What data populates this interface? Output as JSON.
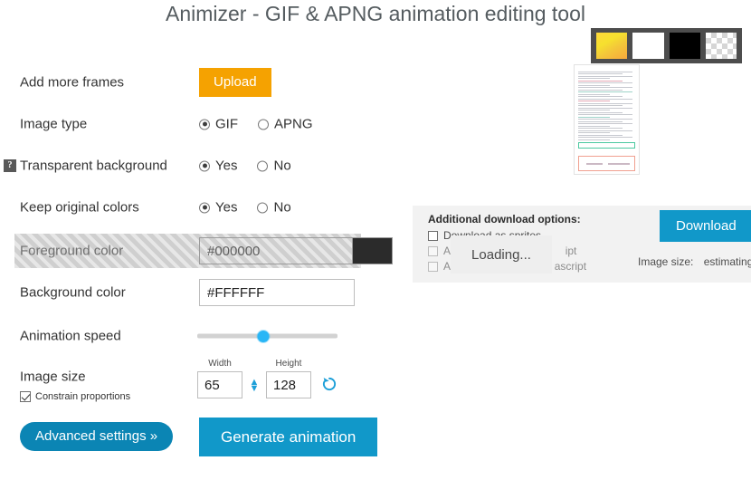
{
  "header": {
    "title": "Animizer - GIF & APNG animation editing tool"
  },
  "swatches": [
    {
      "name": "gradient-swatch",
      "color": "#f6c83a"
    },
    {
      "name": "white-swatch",
      "color": "#ffffff"
    },
    {
      "name": "black-swatch",
      "color": "#000000"
    },
    {
      "name": "transparent-swatch",
      "color": "transparent"
    }
  ],
  "form": {
    "add_frames_label": "Add more frames",
    "upload_button": "Upload",
    "image_type_label": "Image type",
    "image_type_options": [
      {
        "label": "GIF",
        "selected": true
      },
      {
        "label": "APNG",
        "selected": false
      }
    ],
    "transparent_bg_label": "Transparent background",
    "transparent_bg_help": "?",
    "transparent_bg_options": [
      {
        "label": "Yes",
        "selected": true
      },
      {
        "label": "No",
        "selected": false
      }
    ],
    "keep_colors_label": "Keep original colors",
    "keep_colors_options": [
      {
        "label": "Yes",
        "selected": true
      },
      {
        "label": "No",
        "selected": false
      }
    ],
    "foreground_label": "Foreground color",
    "foreground_value": "#000000",
    "foreground_placeholder": "#000000",
    "foreground_chip": "#2b2b2b",
    "background_label": "Background color",
    "background_value": "#FFFFFF",
    "background_placeholder": "#FFFFFF",
    "animation_speed_label": "Animation speed",
    "animation_speed_percent": 47,
    "image_size_label": "Image size",
    "width_caption": "Width",
    "width_value": "65",
    "height_caption": "Height",
    "height_value": "128",
    "constrain_label": "Constrain proportions",
    "constrain_checked": true,
    "advanced_button": "Advanced settings »",
    "generate_button": "Generate animation"
  },
  "download_panel": {
    "title": "Additional download options:",
    "options": [
      {
        "label": "Download as sprites",
        "checked": false,
        "disabled": false
      },
      {
        "label": "An",
        "label_tail": "ipt",
        "checked": false,
        "disabled": true
      },
      {
        "label": "An",
        "label_tail": "ascript",
        "checked": false,
        "disabled": true
      }
    ],
    "download_button": "Download",
    "image_size_label": "Image size:",
    "image_size_value": "estimating.",
    "loading_text": "Loading..."
  },
  "colors": {
    "accent_blue": "#1198c9",
    "accent_orange": "#f5a201",
    "slider_blue": "#29b6f6",
    "pill_blue": "#0b85b4",
    "title_gray": "#555c60",
    "panel_gray": "#f2f2f2"
  }
}
